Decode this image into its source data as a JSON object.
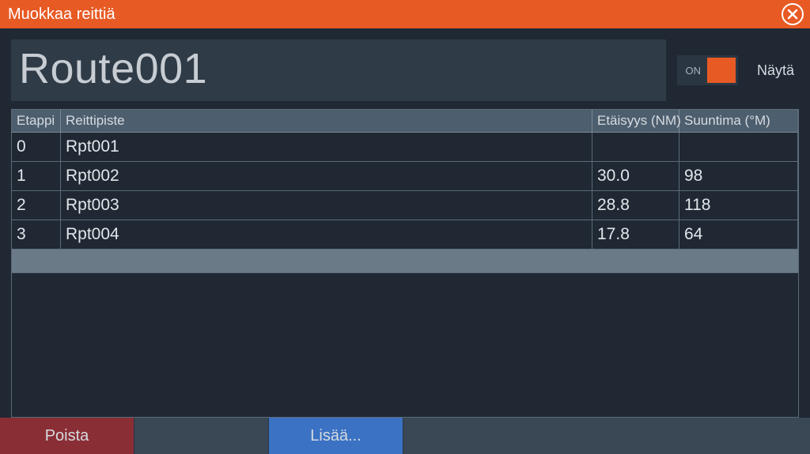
{
  "titlebar": {
    "title": "Muokkaa reittiä"
  },
  "route": {
    "name": "Route001",
    "toggle_on_label": "ON",
    "show_label": "Näytä"
  },
  "columns": {
    "leg": "Etappi",
    "waypoint": "Reittipiste",
    "distance": "Etäisyys (NM)",
    "bearing": "Suuntima (°M)"
  },
  "rows": [
    {
      "leg": "0",
      "waypoint": "Rpt001",
      "distance": "",
      "bearing": ""
    },
    {
      "leg": "1",
      "waypoint": "Rpt002",
      "distance": "30.0",
      "bearing": "98"
    },
    {
      "leg": "2",
      "waypoint": "Rpt003",
      "distance": "28.8",
      "bearing": "118"
    },
    {
      "leg": "3",
      "waypoint": "Rpt004",
      "distance": "17.8",
      "bearing": "64"
    }
  ],
  "footer": {
    "delete": "Poista",
    "add": "Lisää..."
  }
}
